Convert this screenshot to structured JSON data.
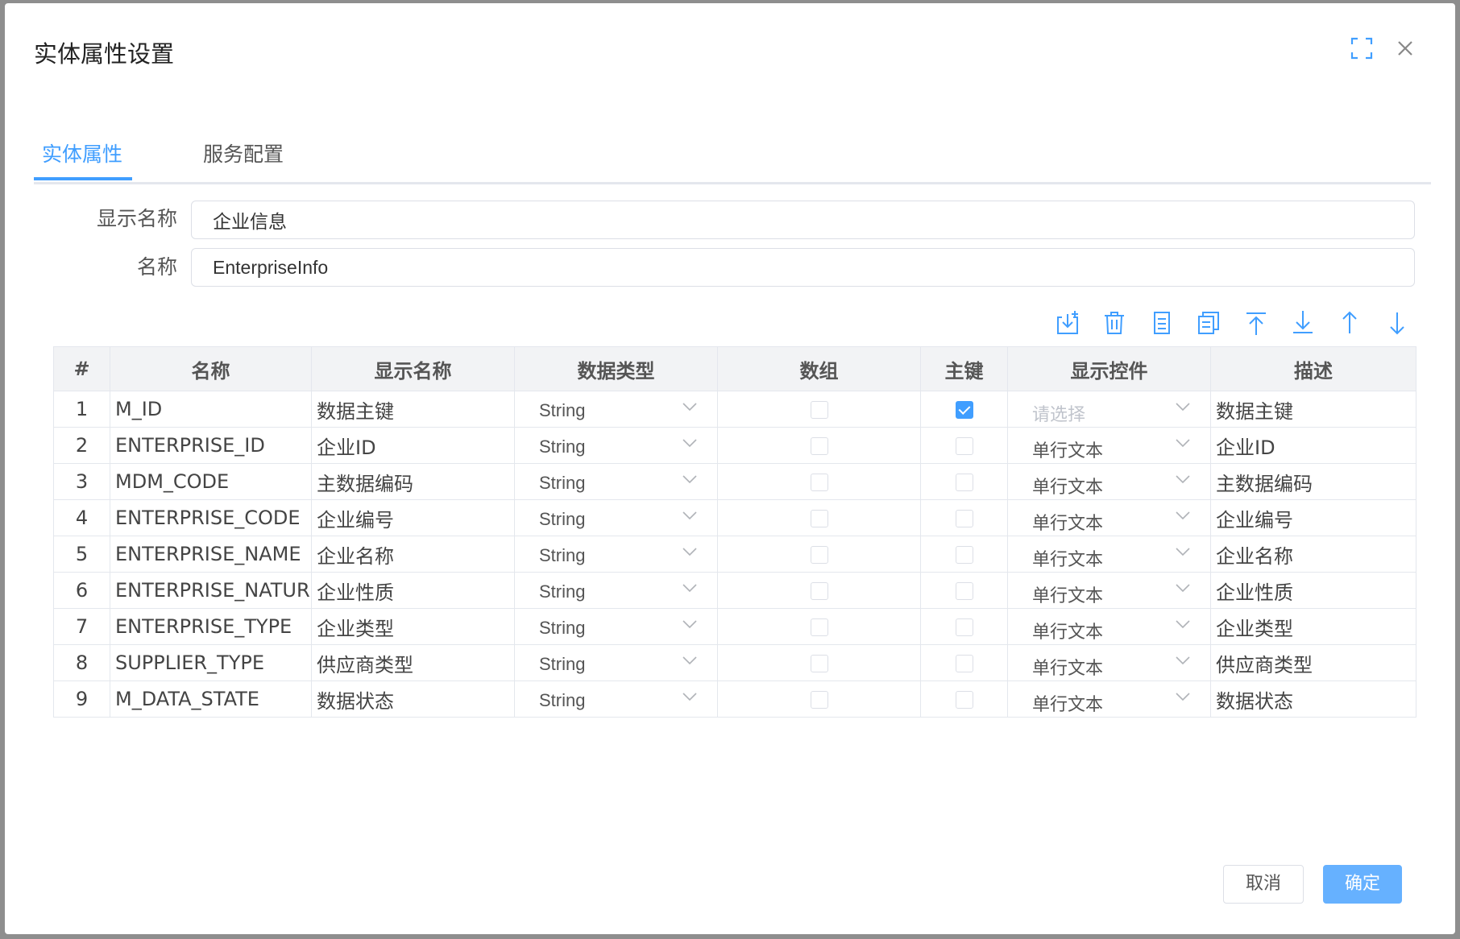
{
  "dialog": {
    "title": "实体属性设置"
  },
  "tabs": [
    {
      "label": "实体属性",
      "active": true
    },
    {
      "label": "服务配置",
      "active": false
    }
  ],
  "form": {
    "display_name": {
      "label": "显示名称",
      "value": "企业信息"
    },
    "name": {
      "label": "名称",
      "value": "EnterpriseInfo"
    }
  },
  "toolbar_icons": [
    "import-icon",
    "delete-icon",
    "document-icon",
    "copy-icon",
    "move-top-icon",
    "move-bottom-icon",
    "move-up-icon",
    "move-down-icon"
  ],
  "table": {
    "columns": [
      "#",
      "名称",
      "显示名称",
      "数据类型",
      "数组",
      "主键",
      "显示控件",
      "描述"
    ],
    "rows": [
      {
        "idx": "1",
        "name": "M_ID",
        "display": "数据主键",
        "type": "String",
        "array": false,
        "pk": true,
        "control": "请选择",
        "control_placeholder": true,
        "desc": "数据主键"
      },
      {
        "idx": "2",
        "name": "ENTERPRISE_ID",
        "display": "企业ID",
        "type": "String",
        "array": false,
        "pk": false,
        "control": "单行文本",
        "control_placeholder": false,
        "desc": "企业ID"
      },
      {
        "idx": "3",
        "name": "MDM_CODE",
        "display": "主数据编码",
        "type": "String",
        "array": false,
        "pk": false,
        "control": "单行文本",
        "control_placeholder": false,
        "desc": "主数据编码"
      },
      {
        "idx": "4",
        "name": "ENTERPRISE_CODE",
        "display": "企业编号",
        "type": "String",
        "array": false,
        "pk": false,
        "control": "单行文本",
        "control_placeholder": false,
        "desc": "企业编号"
      },
      {
        "idx": "5",
        "name": "ENTERPRISE_NAME",
        "display": "企业名称",
        "type": "String",
        "array": false,
        "pk": false,
        "control": "单行文本",
        "control_placeholder": false,
        "desc": "企业名称"
      },
      {
        "idx": "6",
        "name": "ENTERPRISE_NATURE",
        "display": "企业性质",
        "type": "String",
        "array": false,
        "pk": false,
        "control": "单行文本",
        "control_placeholder": false,
        "desc": "企业性质"
      },
      {
        "idx": "7",
        "name": "ENTERPRISE_TYPE",
        "display": "企业类型",
        "type": "String",
        "array": false,
        "pk": false,
        "control": "单行文本",
        "control_placeholder": false,
        "desc": "企业类型"
      },
      {
        "idx": "8",
        "name": "SUPPLIER_TYPE",
        "display": "供应商类型",
        "type": "String",
        "array": false,
        "pk": false,
        "control": "单行文本",
        "control_placeholder": false,
        "desc": "供应商类型"
      },
      {
        "idx": "9",
        "name": "M_DATA_STATE",
        "display": "数据状态",
        "type": "String",
        "array": false,
        "pk": false,
        "control": "单行文本",
        "control_placeholder": false,
        "desc": "数据状态"
      }
    ]
  },
  "footer": {
    "cancel_label": "取消",
    "ok_label": "确定"
  },
  "colors": {
    "primary": "#409eff",
    "ok_button": "#66b1ff",
    "border": "#dcdfe6",
    "header_bg": "#f2f3f5"
  }
}
